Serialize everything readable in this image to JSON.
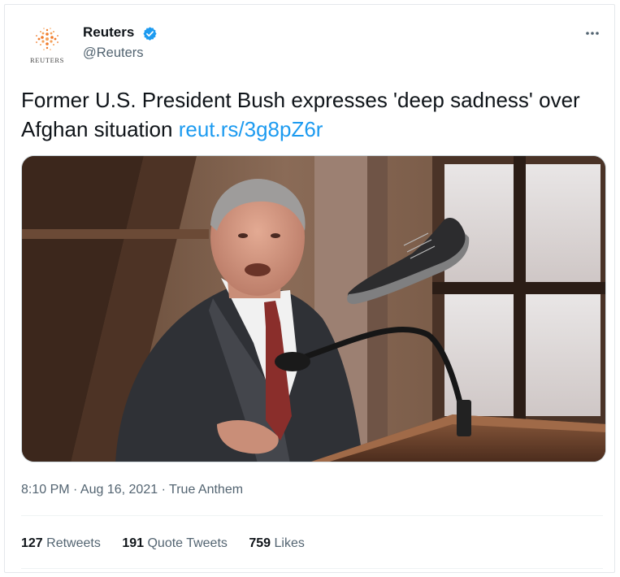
{
  "tweet": {
    "author": {
      "display_name": "Reuters",
      "handle": "@Reuters",
      "avatar_text": "REUTERS",
      "verified": true,
      "avatar_icon": "reuters-dot-logo-icon",
      "verified_icon": "verified-badge-icon"
    },
    "more_icon": "more-options-icon",
    "text": "Former U.S. President Bush expresses 'deep sadness' over Afghan situation ",
    "link": "reut.rs/3g8pZ6r",
    "timestamp": "8:10 PM · Aug 16, 2021 · ",
    "source_app": "True Anthem",
    "stats": {
      "retweets_count": "127",
      "retweets_label": "Retweets",
      "quotes_count": "191",
      "quotes_label": "Quote Tweets",
      "likes_count": "759",
      "likes_label": "Likes"
    }
  },
  "colors": {
    "link": "#1d9bf0",
    "verified": "#1d9bf0",
    "secondary_text": "#536471",
    "reuters_orange": "#f07a2a"
  }
}
